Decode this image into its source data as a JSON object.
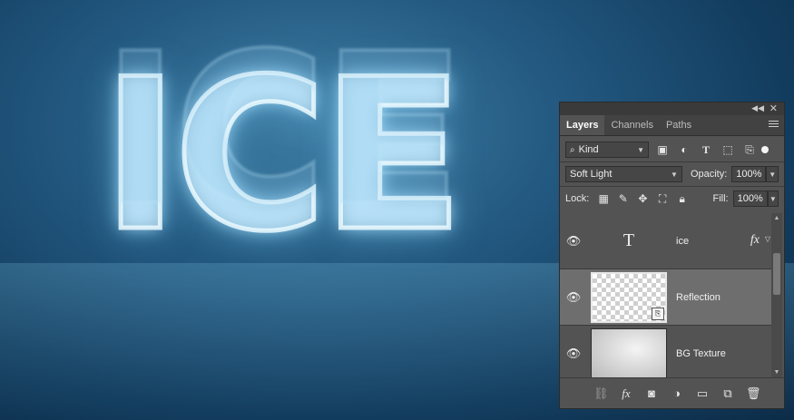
{
  "artwork": {
    "text": "ICE"
  },
  "panel": {
    "tabs": [
      {
        "label": "Layers",
        "active": true
      },
      {
        "label": "Channels",
        "active": false
      },
      {
        "label": "Paths",
        "active": false
      }
    ],
    "filter": {
      "label": "Kind"
    },
    "blend_mode": "Soft Light",
    "opacity_label": "Opacity:",
    "opacity_value": "100%",
    "lock_label": "Lock:",
    "fill_label": "Fill:",
    "fill_value": "100%",
    "layers": [
      {
        "name": "ice",
        "thumb": "type-layer-icon",
        "has_fx": true,
        "visible": true,
        "selected": false,
        "fx_label": "fx"
      },
      {
        "name": "Reflection",
        "thumb": "smart-object",
        "has_fx": false,
        "visible": true,
        "selected": true
      },
      {
        "name": "BG Texture",
        "thumb": "image",
        "has_fx": false,
        "visible": true,
        "selected": false
      }
    ],
    "type_glyph": "T"
  }
}
